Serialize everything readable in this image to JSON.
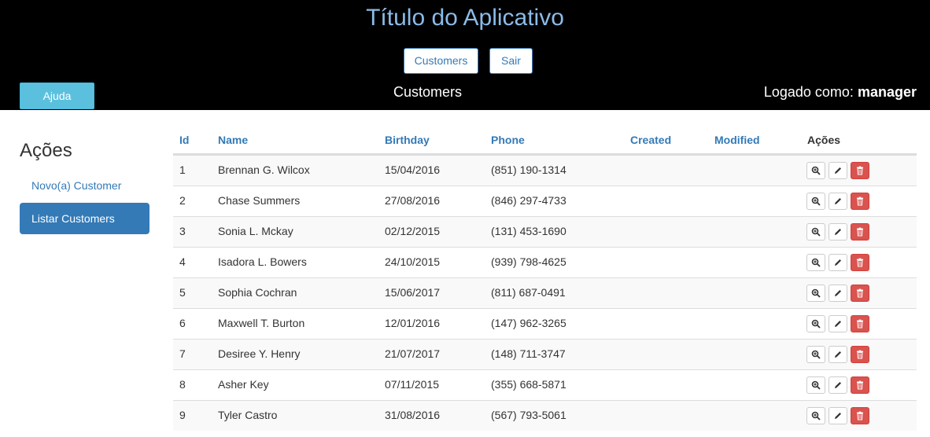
{
  "header": {
    "app_title": "Título do Aplicativo",
    "nav": [
      {
        "label": "Customers"
      },
      {
        "label": "Sair"
      }
    ],
    "help_label": "Ajuda",
    "subtitle": "Customers",
    "logged_prefix": "Logado como:",
    "logged_user": "manager"
  },
  "sidebar": {
    "title": "Ações",
    "new_link": "Novo(a) Customer",
    "list_link": "Listar Customers"
  },
  "table": {
    "columns": [
      "Id",
      "Name",
      "Birthday",
      "Phone",
      "Created",
      "Modified",
      "Ações"
    ],
    "rows": [
      {
        "id": "1",
        "name": "Brennan G. Wilcox",
        "birthday": "15/04/2016",
        "phone": "(851) 190-1314",
        "created": "",
        "modified": ""
      },
      {
        "id": "2",
        "name": "Chase Summers",
        "birthday": "27/08/2016",
        "phone": "(846) 297-4733",
        "created": "",
        "modified": ""
      },
      {
        "id": "3",
        "name": "Sonia L. Mckay",
        "birthday": "02/12/2015",
        "phone": "(131) 453-1690",
        "created": "",
        "modified": ""
      },
      {
        "id": "4",
        "name": "Isadora L. Bowers",
        "birthday": "24/10/2015",
        "phone": "(939) 798-4625",
        "created": "",
        "modified": ""
      },
      {
        "id": "5",
        "name": "Sophia Cochran",
        "birthday": "15/06/2017",
        "phone": "(811) 687-0491",
        "created": "",
        "modified": ""
      },
      {
        "id": "6",
        "name": "Maxwell T. Burton",
        "birthday": "12/01/2016",
        "phone": "(147) 962-3265",
        "created": "",
        "modified": ""
      },
      {
        "id": "7",
        "name": "Desiree Y. Henry",
        "birthday": "21/07/2017",
        "phone": "(148) 711-3747",
        "created": "",
        "modified": ""
      },
      {
        "id": "8",
        "name": "Asher Key",
        "birthday": "07/11/2015",
        "phone": "(355) 668-5871",
        "created": "",
        "modified": ""
      },
      {
        "id": "9",
        "name": "Tyler Castro",
        "birthday": "31/08/2016",
        "phone": "(567) 793-5061",
        "created": "",
        "modified": ""
      }
    ],
    "action_icons": [
      "zoom-in-icon",
      "pencil-icon",
      "trash-icon"
    ]
  },
  "colors": {
    "header_bg": "#000000",
    "title": "#8bbbe8",
    "link": "#337ab7",
    "info_button": "#5bc0de",
    "danger_button": "#d9534f",
    "stripe": "#f9f9f9"
  }
}
